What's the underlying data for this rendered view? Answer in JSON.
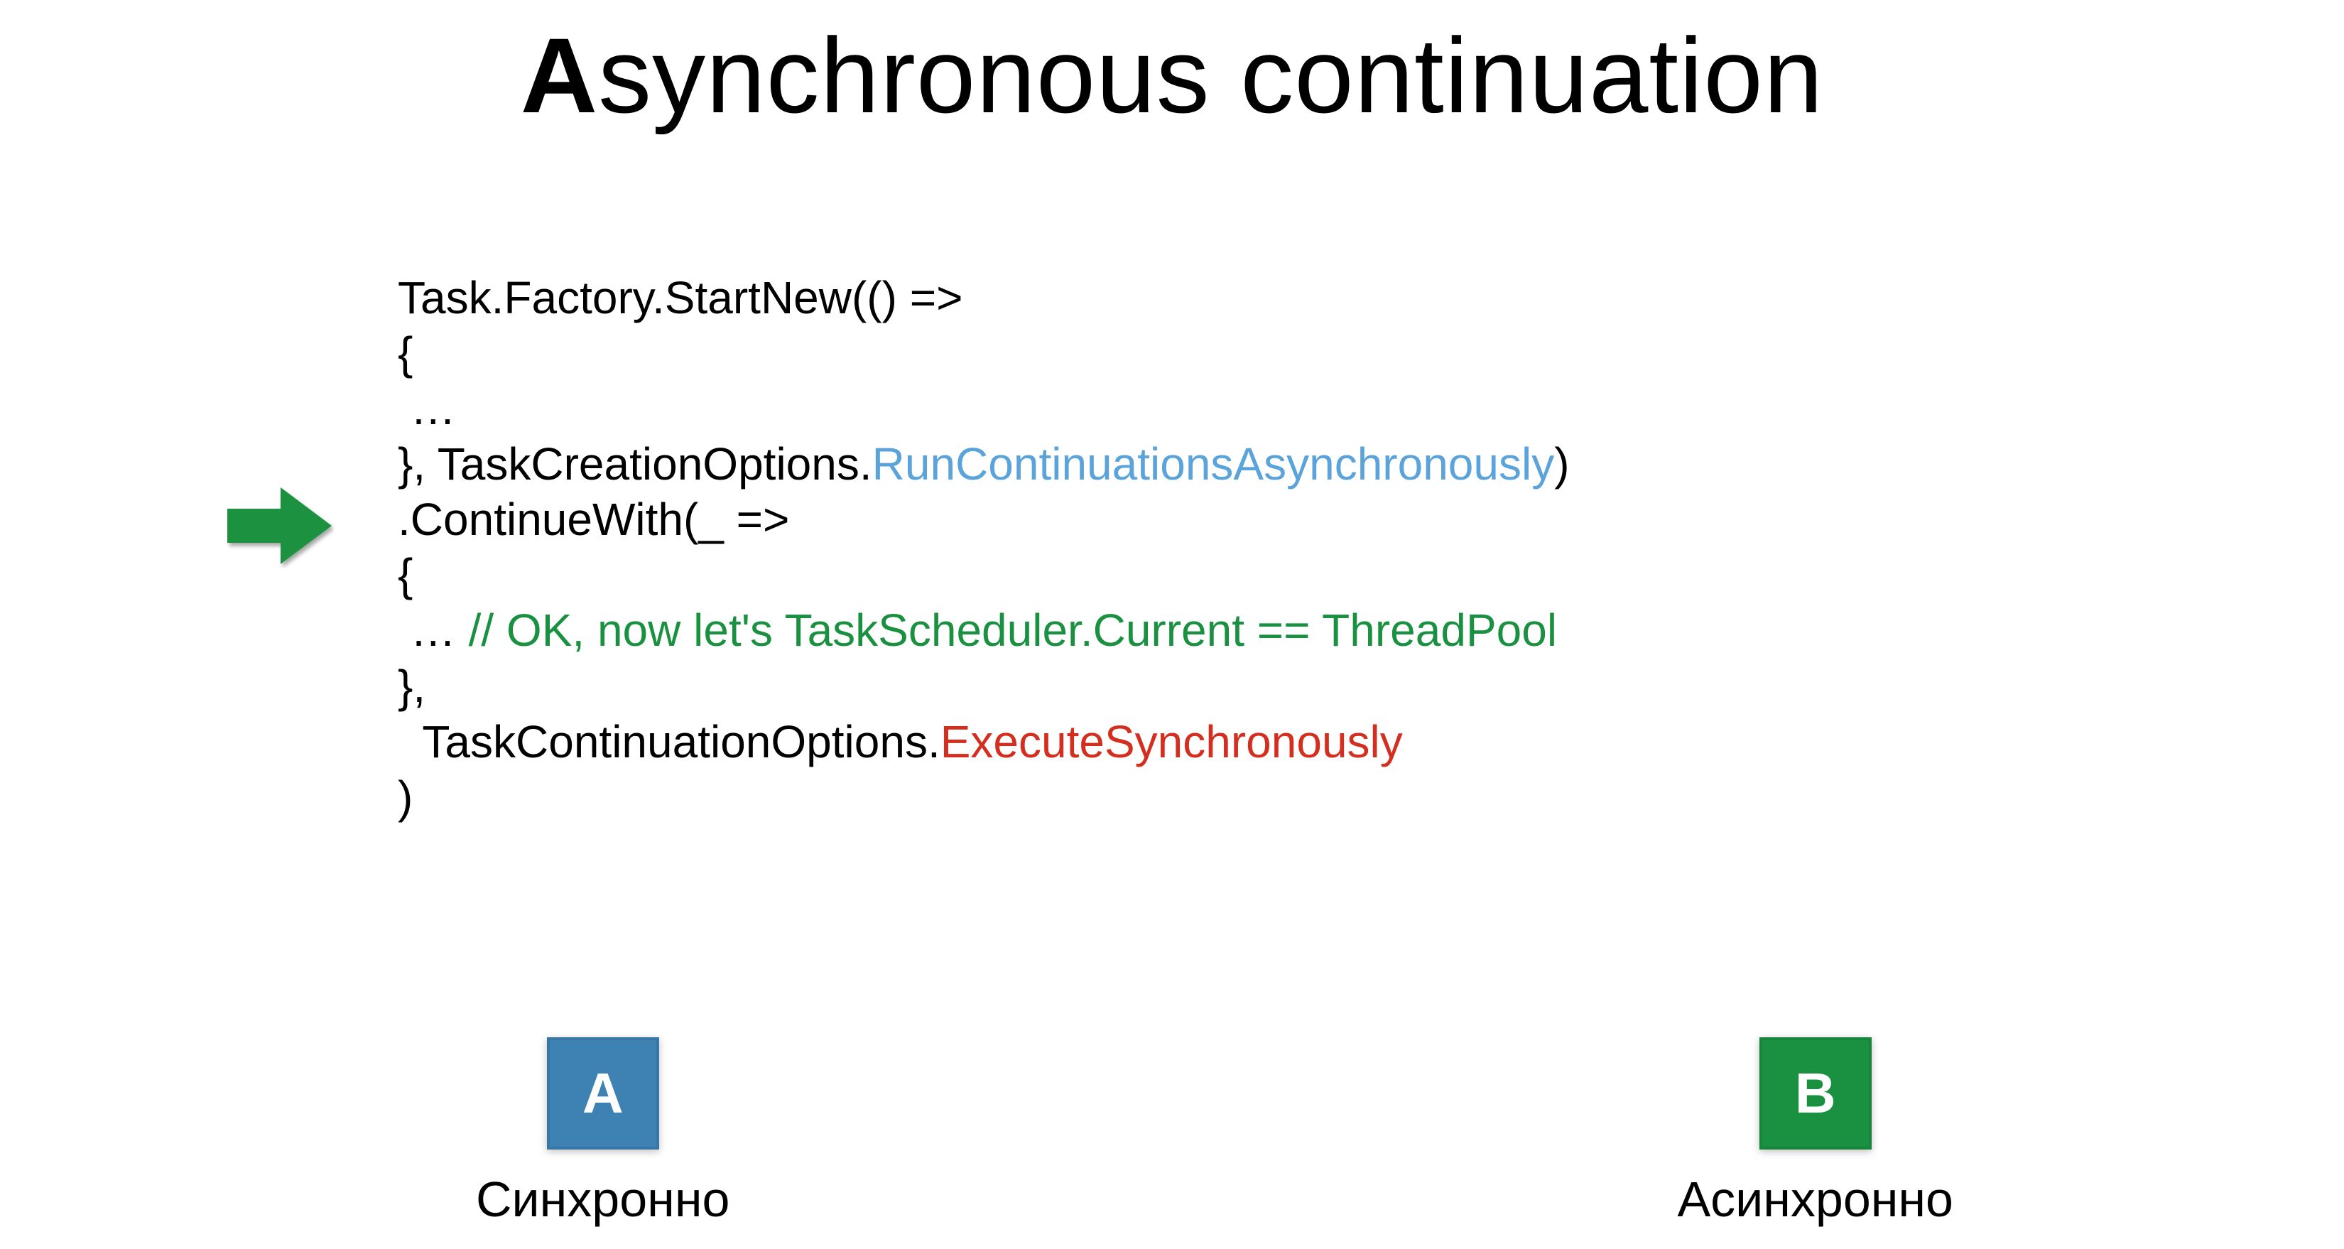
{
  "title": {
    "bold_initial": "A",
    "rest": "synchronous continuation"
  },
  "code": {
    "l1": "Task.Factory.StartNew(() =>",
    "l2": "{",
    "l3": " …",
    "l4_pre": "}, TaskCreationOptions.",
    "l4_blue": "RunContinuationsAsynchronously",
    "l4_post": ")",
    "l5": ".ContinueWith(_ =>",
    "l6": "{",
    "l7_pre": " … ",
    "l7_green": "// OK, now let's TaskScheduler.Current == ThreadPool",
    "l8": "},",
    "l9_pre": "  TaskContinuationOptions.",
    "l9_red": "ExecuteSynchronously",
    "l10": ")"
  },
  "options": {
    "a": {
      "letter": "A",
      "label": "Синхронно"
    },
    "b": {
      "letter": "B",
      "label": "Асинхронно"
    }
  }
}
